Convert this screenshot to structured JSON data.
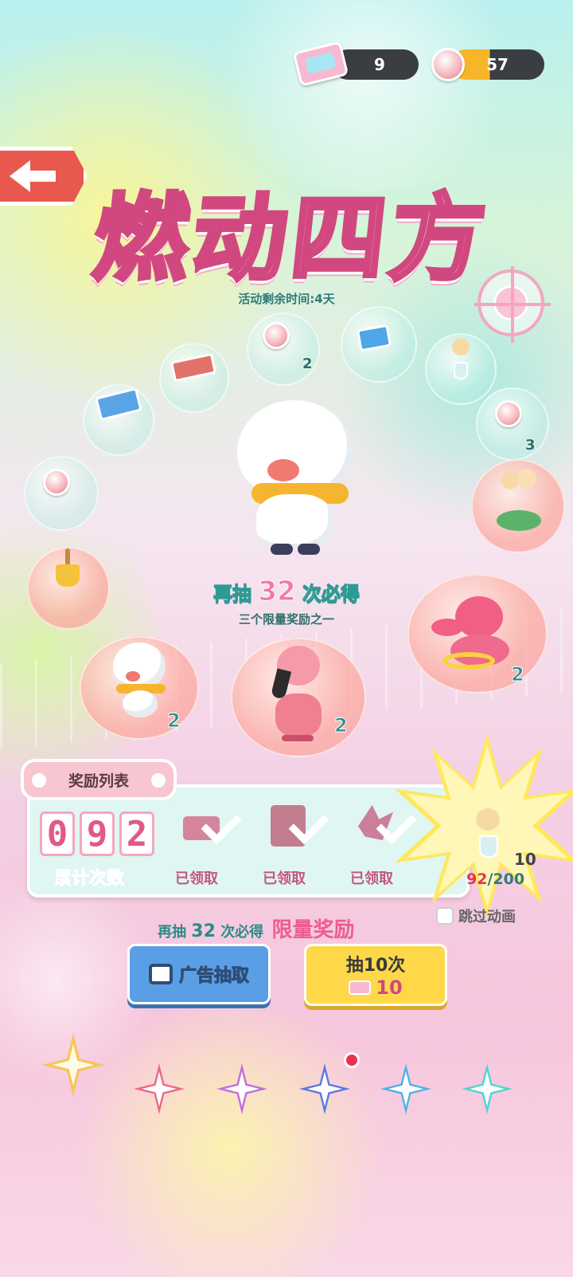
{
  "header": {
    "tickets": "9",
    "coins": "57"
  },
  "title": "燃动四方",
  "time_left": "活动剩余时间:4天",
  "map_counts": {
    "coin_top": "2",
    "coin_right": "3"
  },
  "pity": {
    "prefix": "再抽",
    "num": "32",
    "suffix": "次必得",
    "sub": "三个限量奖励之一"
  },
  "pets": {
    "duck_small": "2",
    "flamingo": "2",
    "dino": "2"
  },
  "reward_list": {
    "tab": "奖励列表",
    "digits": [
      "0",
      "9",
      "2"
    ],
    "count_label": "累计次数",
    "claimed": [
      "已领取",
      "已领取",
      "已领取"
    ]
  },
  "next_reward": {
    "count": "10",
    "progress": "92",
    "total": "/200",
    "progress_fraction": 0.46
  },
  "skip_animation": "跳过动画",
  "bottom_pity": {
    "prefix": "再抽",
    "num": "32",
    "mid": "次必得",
    "tail": "限量奖励"
  },
  "buttons": {
    "ad_draw": "广告抽取",
    "draw10": "抽10次",
    "draw10_cost": "10"
  },
  "colors": {
    "accent_pink": "#f58fb2",
    "button_blue": "#5a9fe6",
    "button_yellow": "#ffd84a",
    "back_red": "#e8584f"
  }
}
